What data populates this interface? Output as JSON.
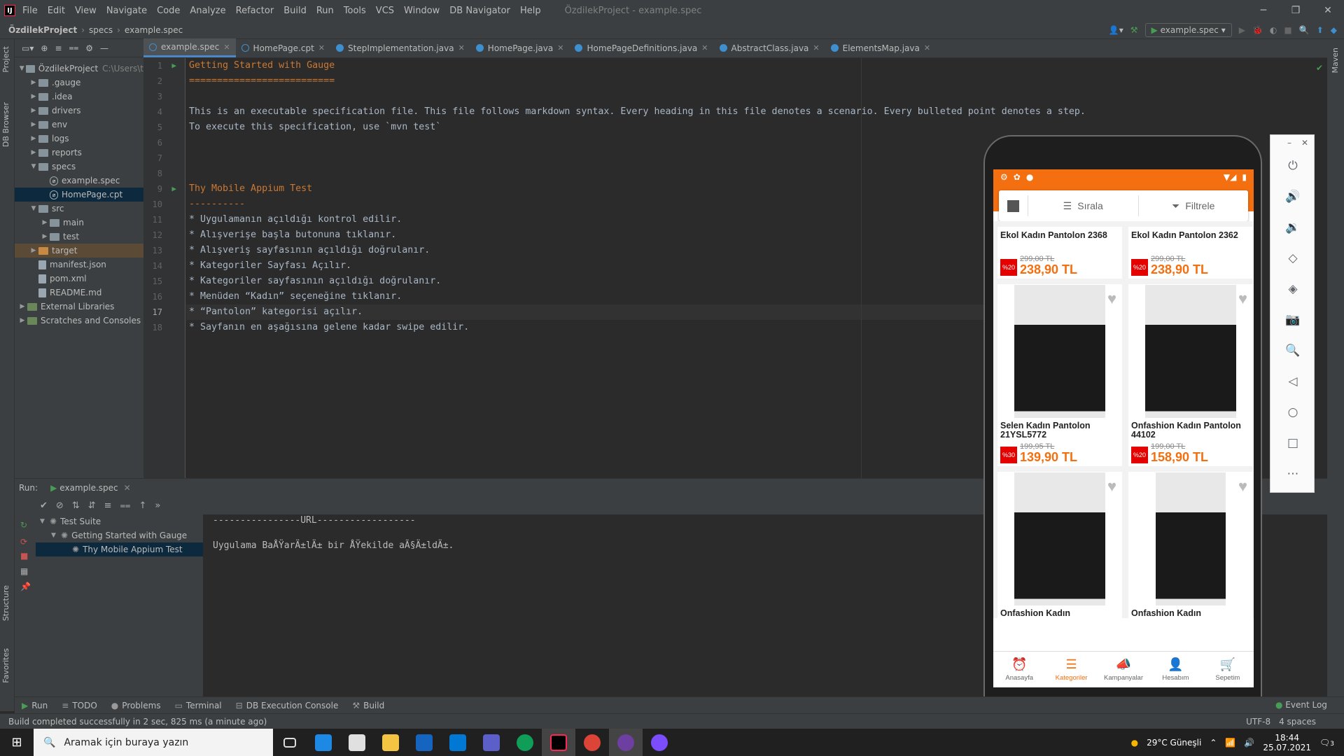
{
  "window": {
    "menu": [
      "File",
      "Edit",
      "View",
      "Navigate",
      "Code",
      "Analyze",
      "Refactor",
      "Build",
      "Run",
      "Tools",
      "VCS",
      "Window",
      "DB Navigator",
      "Help"
    ],
    "title": "ÖzdilekProject - example.spec"
  },
  "navbar": {
    "crumbs": [
      "ÖzdilekProject",
      "specs",
      "example.spec"
    ],
    "run_config": "example.spec"
  },
  "left_stripe": {
    "project": "Project",
    "db_browser": "DB Browser",
    "structure": "Structure",
    "favorites": "Favorites"
  },
  "right_stripe": {
    "maven": "Maven"
  },
  "project_tree": [
    {
      "label": "ÖzdilekProject",
      "extra": "C:\\Users\\t",
      "level": 0,
      "type": "folder",
      "open": true
    },
    {
      "label": ".gauge",
      "level": 1,
      "type": "folder"
    },
    {
      "label": ".idea",
      "level": 1,
      "type": "folder"
    },
    {
      "label": "drivers",
      "level": 1,
      "type": "folder"
    },
    {
      "label": "env",
      "level": 1,
      "type": "folder"
    },
    {
      "label": "logs",
      "level": 1,
      "type": "folder"
    },
    {
      "label": "reports",
      "level": 1,
      "type": "folder"
    },
    {
      "label": "specs",
      "level": 1,
      "type": "folder",
      "open": true
    },
    {
      "label": "example.spec",
      "level": 2,
      "type": "spec"
    },
    {
      "label": "HomePage.cpt",
      "level": 2,
      "type": "spec",
      "selected": true
    },
    {
      "label": "src",
      "level": 1,
      "type": "folder",
      "open": true
    },
    {
      "label": "main",
      "level": 2,
      "type": "folder"
    },
    {
      "label": "test",
      "level": 2,
      "type": "folder"
    },
    {
      "label": "target",
      "level": 1,
      "type": "folder-orange",
      "highlight": true
    },
    {
      "label": "manifest.json",
      "level": 1,
      "type": "file"
    },
    {
      "label": "pom.xml",
      "level": 1,
      "type": "file"
    },
    {
      "label": "README.md",
      "level": 1,
      "type": "file"
    },
    {
      "label": "External Libraries",
      "level": 0,
      "type": "lib"
    },
    {
      "label": "Scratches and Consoles",
      "level": 0,
      "type": "lib"
    }
  ],
  "editor_tabs": [
    {
      "label": "example.spec",
      "active": true,
      "kind": "spec"
    },
    {
      "label": "HomePage.cpt",
      "kind": "spec"
    },
    {
      "label": "StepImplementation.java",
      "kind": "java"
    },
    {
      "label": "HomePage.java",
      "kind": "java"
    },
    {
      "label": "HomePageDefinitions.java",
      "kind": "java"
    },
    {
      "label": "AbstractClass.java",
      "kind": "java"
    },
    {
      "label": "ElementsMap.java",
      "kind": "java"
    }
  ],
  "code_lines": [
    {
      "n": "1",
      "text": "Getting Started with Gauge",
      "style": "h",
      "run": true
    },
    {
      "n": "2",
      "text": "==========================",
      "style": "h"
    },
    {
      "n": "3",
      "text": "",
      "style": "txt"
    },
    {
      "n": "4",
      "text": "This is an executable specification file. This file follows markdown syntax. Every heading in this file denotes a scenario. Every bulleted point denotes a step.",
      "style": "txt"
    },
    {
      "n": "5",
      "text": "To execute this specification, use `mvn test`",
      "style": "txt"
    },
    {
      "n": "6",
      "text": "",
      "style": "txt"
    },
    {
      "n": "7",
      "text": "",
      "style": "txt"
    },
    {
      "n": "8",
      "text": "",
      "style": "txt"
    },
    {
      "n": "9",
      "text": "Thy Mobile Appium Test",
      "style": "h",
      "run": true
    },
    {
      "n": "10",
      "text": "----------",
      "style": "h"
    },
    {
      "n": "11",
      "text": "* Uygulamanın açıldığı kontrol edilir.",
      "style": "txt"
    },
    {
      "n": "12",
      "text": "* Alışverişe başla butonuna tıklanır.",
      "style": "txt"
    },
    {
      "n": "13",
      "text": "* Alışveriş sayfasının açıldığı doğrulanır.",
      "style": "txt"
    },
    {
      "n": "14",
      "text": "* Kategoriler Sayfası Açılır.",
      "style": "txt"
    },
    {
      "n": "15",
      "text": "* Kategoriler sayfasının açıldığı doğrulanır.",
      "style": "txt"
    },
    {
      "n": "16",
      "text": "* Menüden “Kadın” seçeneğine tıklanır.",
      "style": "txt"
    },
    {
      "n": "17",
      "text": "* “Pantolon” kategorisi açılır.",
      "style": "txt",
      "current": true
    },
    {
      "n": "18",
      "text": "* Sayfanın en aşağısına gelene kadar swipe edilir.",
      "style": "txt"
    }
  ],
  "run_panel": {
    "label": "Run:",
    "tab": "example.spec",
    "tree": [
      {
        "label": "Test Suite",
        "level": 0
      },
      {
        "label": "Getting Started with Gauge",
        "level": 1
      },
      {
        "label": "Thy Mobile Appium Test",
        "level": 2,
        "selected": true
      }
    ],
    "output": [
      "----------------URL------------------",
      "",
      "Uygulama BaÅŸarÄ±lÄ± bir ÅŸekilde aÃ§Ä±ldÄ±."
    ]
  },
  "bottom_tabs": [
    "Run",
    "TODO",
    "Problems",
    "Terminal",
    "DB Execution Console",
    "Build"
  ],
  "event_log": "Event Log",
  "status": {
    "message": "Build completed successfully in 2 sec, 825 ms (a minute ago)",
    "encoding": "UTF-8",
    "indent": "4 spaces"
  },
  "phone": {
    "sort_label": "Sırala",
    "filter_label": "Filtrele",
    "products": [
      {
        "name": "Ekol Kadın Pantolon 2368",
        "old": "299,00 TL",
        "price": "238,90 TL",
        "disc": "%20",
        "image": false
      },
      {
        "name": "Ekol Kadın Pantolon 2362",
        "old": "299,00 TL",
        "price": "238,90 TL",
        "disc": "%20",
        "image": false
      },
      {
        "name": "Selen Kadın Pantolon 21YSL5772",
        "old": "199,95 TL",
        "price": "139,90 TL",
        "disc": "%30",
        "image": true
      },
      {
        "name": "Onfashion Kadın Pantolon 44102",
        "old": "199,00 TL",
        "price": "158,90 TL",
        "disc": "%20",
        "image": true
      },
      {
        "name": "Onfashion Kadın",
        "old": "",
        "price": "",
        "disc": "",
        "image": true
      },
      {
        "name": "Onfashion Kadın",
        "old": "",
        "price": "",
        "disc": "",
        "image": true
      }
    ],
    "bottom_nav": [
      "Anasayfa",
      "Kategoriler",
      "Kampanyalar",
      "Hesabım",
      "Sepetim"
    ],
    "accent": "#f36f0f"
  },
  "taskbar": {
    "search_placeholder": "Aramak için buraya yazın",
    "weather": "29°C  Güneşli",
    "time": "18:44",
    "date": "25.07.2021",
    "notif": "3"
  }
}
